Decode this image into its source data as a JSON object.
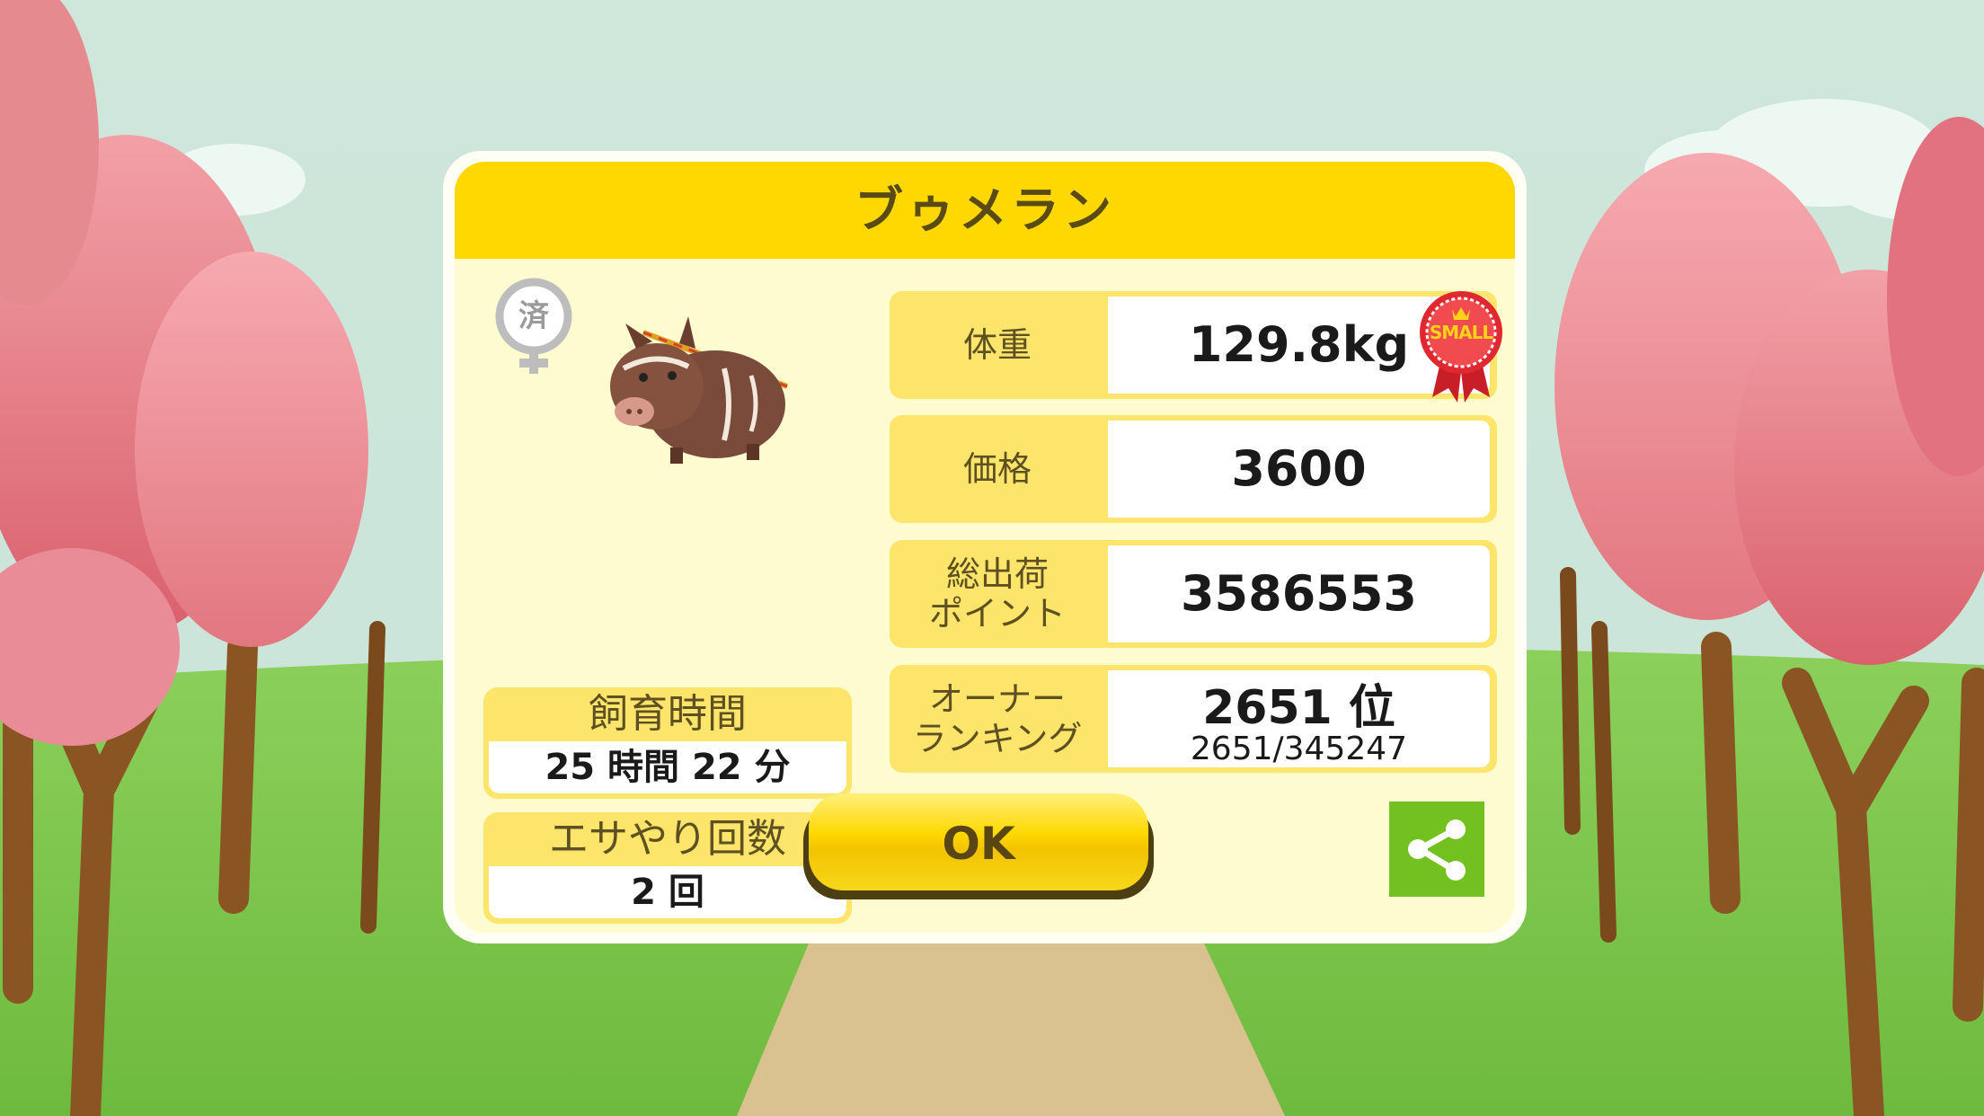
{
  "pig_name": "ブゥメラン",
  "shipped_badge": "済",
  "stats": {
    "weight": {
      "label": "体重",
      "value": "129.8kg",
      "size_badge": "SMALL"
    },
    "price": {
      "label": "価格",
      "value": "3600"
    },
    "shipment_points": {
      "label_line1": "総出荷",
      "label_line2": "ポイント",
      "value": "3586553"
    },
    "owner_ranking": {
      "label_line1": "オーナー",
      "label_line2": "ランキング",
      "value": "2651 位",
      "detail": "2651/345247"
    }
  },
  "raising_time": {
    "label": "飼育時間",
    "value": "25 時間 22 分"
  },
  "feeding_count": {
    "label": "エサやり回数",
    "value": "2 回"
  },
  "ok_button": "OK",
  "icons": {
    "share": "share-icon",
    "gender": "female-icon"
  },
  "colors": {
    "title_bar": "#fed800",
    "panel": "#fffbd0",
    "share": "#72c121",
    "badge_red": "#d8222a"
  }
}
